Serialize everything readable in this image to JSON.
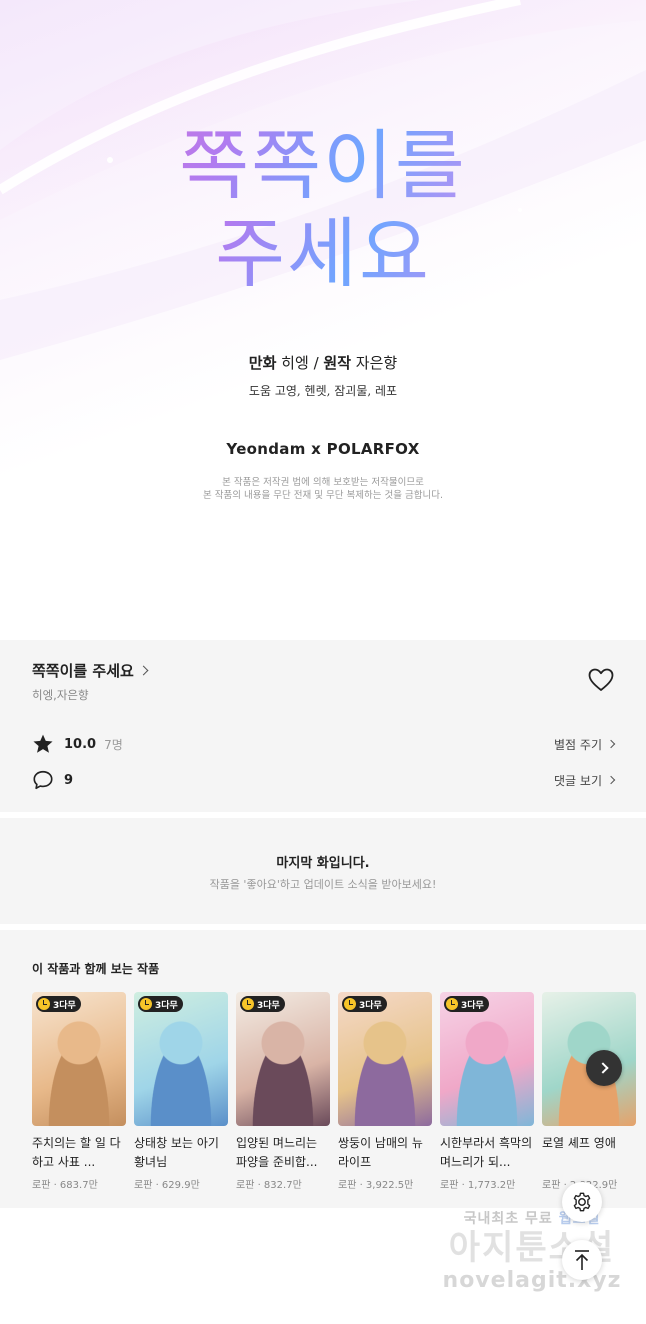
{
  "cover": {
    "title_line1": "쪽쪽이를",
    "title_line2": "주세요",
    "credit_manhwa_label": "만화",
    "credit_manhwa_name": "히엥",
    "credit_separator": "/",
    "credit_original_label": "원작",
    "credit_original_name": "자은향",
    "credit_helpers": "도움 고영, 헨렛, 잠괴물, 레포",
    "publisher": "Yeondam x POLARFOX",
    "notice_line1": "본 작품은 저작권 법에 의해 보호받는 저작물이므로",
    "notice_line2": "본 작품의 내용을 무단 전재 및 무단 복제하는 것을 금합니다."
  },
  "info": {
    "title": "쪽쪽이를 주세요",
    "authors": "히엥,자은향",
    "rating_value": "10.0",
    "rating_count": "7명",
    "rate_action": "별점 주기",
    "comment_count": "9",
    "comment_action": "댓글 보기"
  },
  "last_episode": {
    "heading": "마지막 화입니다.",
    "subtext": "작품을 '좋아요'하고 업데이트 소식을 받아보세요!"
  },
  "recommendations": {
    "heading": "이 작품과 함께 보는 작품",
    "items": [
      {
        "badge": "3다무",
        "title": "주치의는 할 일 다 하고 사표 ...",
        "genre_views": "로판 · 683.7만",
        "colors": [
          "#f7e4cf",
          "#e8b98a",
          "#c48f5e"
        ]
      },
      {
        "badge": "3다무",
        "title": "상태창 보는 아기 황녀님",
        "genre_views": "로판 · 629.9만",
        "colors": [
          "#cfeee0",
          "#9fd5e8",
          "#5a8fc9"
        ]
      },
      {
        "badge": "3다무",
        "title": "입양된 며느리는 파양을 준비합...",
        "genre_views": "로판 · 832.7만",
        "colors": [
          "#f3ece4",
          "#d9b4a6",
          "#6a4a5a"
        ]
      },
      {
        "badge": "3다무",
        "title": "쌍둥이 남매의 뉴라이프",
        "genre_views": "로판 · 3,922.5만",
        "colors": [
          "#f5d9c9",
          "#e6c38a",
          "#8d6a9e"
        ]
      },
      {
        "badge": "3다무",
        "title": "시한부라서 흑막의 며느리가 되...",
        "genre_views": "로판 · 1,773.2만",
        "colors": [
          "#f6d3e6",
          "#f0a8c8",
          "#7fb6d8"
        ]
      },
      {
        "badge": "",
        "title": "로열 셰프 영애",
        "genre_views": "로판 · 2,822.9만",
        "colors": [
          "#e7f1e8",
          "#9fd6c9",
          "#e6a26a"
        ]
      }
    ]
  },
  "watermark": {
    "line1_a": "국내최초 무료",
    "line1_b": "웹소설",
    "line2": "아지툰소설",
    "line3": "novelagit.xyz"
  },
  "icons": {
    "like": "heart-icon",
    "rating": "star-icon",
    "comment": "speech-bubble-icon",
    "next": "chevron-right-icon",
    "settings": "gear-icon",
    "top": "arrow-up-icon"
  }
}
